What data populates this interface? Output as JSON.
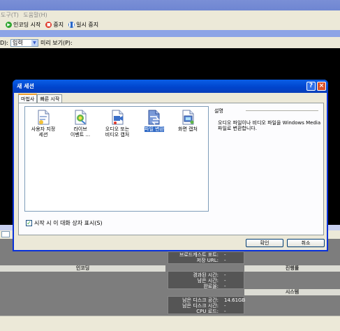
{
  "menu": {
    "tools": "도구(T)",
    "help": "도움말(H)"
  },
  "toolbar": {
    "start_encoding": "인코딩 시작",
    "stop": "중지",
    "pause": "일시 중지"
  },
  "source": {
    "prefix": "D):",
    "selected": "입력",
    "preview_label": "미리 보기(P):"
  },
  "status": {
    "encoding_header": "인코딩",
    "progress_header": "진행률",
    "system_header": "시스템",
    "broadcast_port_label": "브로드캐스트 포트:",
    "broadcast_port_value": "-",
    "archive_url_label": "저장 URL:",
    "archive_url_value": "-",
    "elapsed_label": "경과된 시간:",
    "elapsed_value": "-",
    "remaining_label": "남은 시간:",
    "remaining_value": "-",
    "completed_label": "완료율:",
    "completed_value": "-",
    "disk_free_label": "남은 디스크 공간:",
    "disk_free_value": "14.61GB",
    "disk_time_label": "남은 디스크 시간:",
    "disk_time_value": "-",
    "cpu_label": "CPU 로드:",
    "cpu_value": "-"
  },
  "dialog": {
    "title": "새 세션",
    "help_button": "?",
    "close_button": "×",
    "tabs": [
      "마법사",
      "빠른 시작"
    ],
    "wizards": [
      {
        "line1": "사용자 지정",
        "line2": "세션",
        "icon": "custom-session-icon"
      },
      {
        "line1": "라이브",
        "line2": "이벤트 ...",
        "icon": "live-event-icon"
      },
      {
        "line1": "오디오 또는",
        "line2": "비디오 캡처",
        "icon": "capture-icon"
      },
      {
        "line1": "파일 변환",
        "line2": "",
        "icon": "file-convert-icon"
      },
      {
        "line1": "화면 캡처",
        "line2": "",
        "icon": "screen-capture-icon"
      }
    ],
    "selected_wizard": "파일 변환",
    "description_title": "설명",
    "description_text": "오디오 파일이나 비디오 파일을 Windows Media 파일로 변환합니다.",
    "show_on_start_label": "시작 시 이 대화 상자 표시(S)",
    "show_on_start_checked": true,
    "ok_label": "확인",
    "cancel_label": "취소"
  },
  "colors": {
    "title_blue": "#0a5ee6",
    "selection_blue": "#316ac5",
    "stop_red": "#e0382b",
    "start_green": "#2ea52e",
    "pause_blue": "#2867c8"
  }
}
